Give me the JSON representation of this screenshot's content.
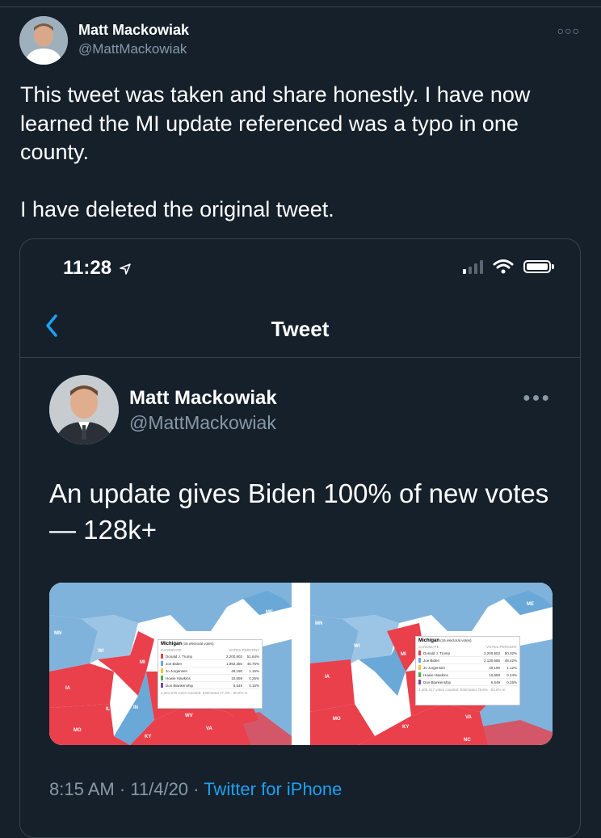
{
  "outer": {
    "name": "Matt Mackowiak",
    "handle": "@MattMackowiak",
    "more_icon": "more-dots-icon",
    "text": "This tweet was taken and share honestly. I have now learned the MI update referenced was a typo in one county.\n\nI have deleted the original tweet."
  },
  "quoted": {
    "status_time": "11:28",
    "location_icon": "location-arrow-icon",
    "nav_title": "Tweet",
    "name": "Matt Mackowiak",
    "handle": "@MattMackowiak",
    "text": "An update gives Biden 100% of new votes — 128k+",
    "timestamp": "8:15 AM · 11/4/20 · ",
    "source": "Twitter for iPhone",
    "maps": [
      {
        "title": "Michigan",
        "subtitle": "(16 electoral votes)",
        "header": [
          "CANDIDATE",
          "VOTES",
          "PERCENT"
        ],
        "rows": [
          {
            "name": "Donald J. Trump",
            "votes": "2,200,902",
            "pct": "51.64%",
            "color": "#e9404b"
          },
          {
            "name": "Joe Biden",
            "votes": "1,992,356",
            "pct": "46.75%",
            "color": "#6aa8d8"
          },
          {
            "name": "Jo Jorgensen",
            "votes": "49,190",
            "pct": "1.15%",
            "color": "#f2c443"
          },
          {
            "name": "Howie Hawkins",
            "votes": "10,659",
            "pct": "0.25%",
            "color": "#4caf50"
          },
          {
            "name": "Don Blankenship",
            "votes": "6,549",
            "pct": "0.15%",
            "color": "#7b4aa0"
          }
        ],
        "footer": "4,261,678 votes counted. Estimated 77.3% - 80.8% in",
        "labels": [
          "MN",
          "WI",
          "MI",
          "IA",
          "IL",
          "IN",
          "MO",
          "KY",
          "VA",
          "WV",
          "ME"
        ]
      },
      {
        "title": "Michigan",
        "subtitle": "(16 electoral votes)",
        "header": [
          "CANDIDATE",
          "VOTES",
          "PERCENT"
        ],
        "rows": [
          {
            "name": "Donald J. Trump",
            "votes": "2,200,902",
            "pct": "50.02%",
            "color": "#e9404b"
          },
          {
            "name": "Joe Biden",
            "votes": "2,130,686",
            "pct": "48.42%",
            "color": "#6aa8d8"
          },
          {
            "name": "Jo Jorgensen",
            "votes": "49,190",
            "pct": "1.12%",
            "color": "#f2c443"
          },
          {
            "name": "Howie Hawkins",
            "votes": "10,659",
            "pct": "0.24%",
            "color": "#4caf50"
          },
          {
            "name": "Don Blankenship",
            "votes": "6,549",
            "pct": "0.15%",
            "color": "#7b4aa0"
          }
        ],
        "footer": "4,400,217 votes counted. Estimated 79.6% - 83.8% in",
        "labels": [
          "MN",
          "WI",
          "MI",
          "IA",
          "IL",
          "IN",
          "MO",
          "KY",
          "VA",
          "ME",
          "NC"
        ]
      }
    ]
  },
  "colors": {
    "background": "#15202b",
    "border": "#38444d",
    "secondary_text": "#8899a6",
    "accent": "#1da1f2",
    "republican": "#e9404b",
    "democrat": "#6aa8d8"
  }
}
